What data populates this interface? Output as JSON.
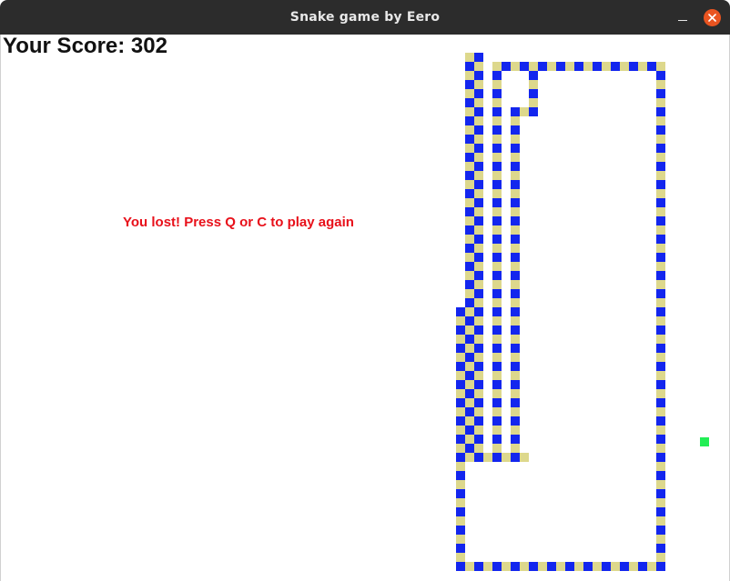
{
  "window": {
    "title": "Snake game by Eero"
  },
  "game": {
    "score_text": "Your Score: 302",
    "score": 302,
    "message": "You lost! Press Q or C to play again",
    "colors": {
      "message": "#e8101a",
      "snake_blue": "#1326ee",
      "snake_khaki": "#ddd88c",
      "food": "#22ee55",
      "score": "#111111"
    }
  }
}
